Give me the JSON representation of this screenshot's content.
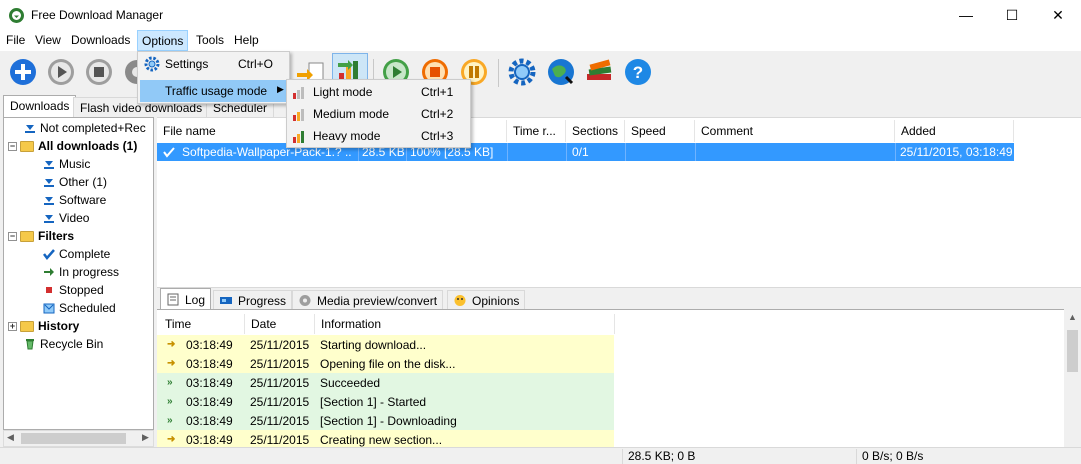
{
  "window": {
    "title": "Free Download Manager",
    "minimize": "—",
    "maximize": "☐",
    "close": "✕"
  },
  "menu": [
    "File",
    "View",
    "Downloads",
    "Options",
    "Tools",
    "Help"
  ],
  "options_menu": {
    "items": [
      {
        "label": "Settings",
        "shortcut": "Ctrl+O",
        "icon": "gear-icon"
      },
      {
        "label": "Traffic usage mode",
        "shortcut": "",
        "icon": ""
      }
    ],
    "submenu": [
      {
        "label": "Light mode",
        "shortcut": "Ctrl+1",
        "icon": "light-mode-icon"
      },
      {
        "label": "Medium mode",
        "shortcut": "Ctrl+2",
        "icon": "medium-mode-icon"
      },
      {
        "label": "Heavy mode",
        "shortcut": "Ctrl+3",
        "icon": "heavy-mode-icon"
      }
    ]
  },
  "left_tabs": [
    "Downloads",
    "Flash video downloads",
    "Scheduler"
  ],
  "tree": [
    {
      "label": "Not completed+Rec",
      "level": 1,
      "bold": false,
      "icon": "arrow-down-icon"
    },
    {
      "label": "All downloads (1)",
      "level": 0,
      "bold": true,
      "icon": "folder-icon"
    },
    {
      "label": "Music",
      "level": 1,
      "bold": false,
      "icon": "arrow-down-icon"
    },
    {
      "label": "Other (1)",
      "level": 1,
      "bold": false,
      "icon": "arrow-down-icon"
    },
    {
      "label": "Software",
      "level": 1,
      "bold": false,
      "icon": "arrow-down-icon"
    },
    {
      "label": "Video",
      "level": 1,
      "bold": false,
      "icon": "arrow-down-icon"
    },
    {
      "label": "Filters",
      "level": 0,
      "bold": true,
      "icon": "folder-icon"
    },
    {
      "label": "Complete",
      "level": 1,
      "bold": false,
      "icon": "check-icon"
    },
    {
      "label": "In progress",
      "level": 1,
      "bold": false,
      "icon": "green-arrow-icon"
    },
    {
      "label": "Stopped",
      "level": 1,
      "bold": false,
      "icon": "stop-icon"
    },
    {
      "label": "Scheduled",
      "level": 1,
      "bold": false,
      "icon": "scheduled-icon"
    },
    {
      "label": "History",
      "level": 0,
      "bold": true,
      "icon": "folder-icon"
    },
    {
      "label": "Recycle Bin",
      "level": 0,
      "bold": false,
      "icon": "recycle-icon"
    }
  ],
  "columns": [
    "File name",
    "ed",
    "Time r...",
    "Sections",
    "Speed",
    "Comment",
    "Added"
  ],
  "download_row": {
    "file": "Softpedia-Wallpaper-Pack-1.? ...",
    "size": "28.5 KB",
    "progress": "100% [28.5 KB]",
    "sections": "0/1",
    "added": "25/11/2015, 03:18:49"
  },
  "bottom_tabs": [
    "Log",
    "Progress",
    "Media preview/convert",
    "Opinions"
  ],
  "log_columns": [
    "Time",
    "Date",
    "Information"
  ],
  "log_rows": [
    {
      "time": "03:18:49",
      "date": "25/11/2015",
      "info": "Starting download...",
      "type": "info"
    },
    {
      "time": "03:18:49",
      "date": "25/11/2015",
      "info": "Opening file on the disk...",
      "type": "info"
    },
    {
      "time": "03:18:49",
      "date": "25/11/2015",
      "info": "Succeeded",
      "type": "success"
    },
    {
      "time": "03:18:49",
      "date": "25/11/2015",
      "info": "[Section 1] - Started",
      "type": "success"
    },
    {
      "time": "03:18:49",
      "date": "25/11/2015",
      "info": "[Section 1] - Downloading",
      "type": "success"
    },
    {
      "time": "03:18:49",
      "date": "25/11/2015",
      "info": "Creating new section...",
      "type": "info"
    }
  ],
  "status": {
    "transfer": "28.5 KB; 0 B",
    "speed": "0 B/s; 0 B/s"
  },
  "colors": {
    "info_row": "#ffffcc",
    "success_row": "#e2f7e2",
    "selection": "#3399ff",
    "menu_highlight": "#91c9f7"
  }
}
